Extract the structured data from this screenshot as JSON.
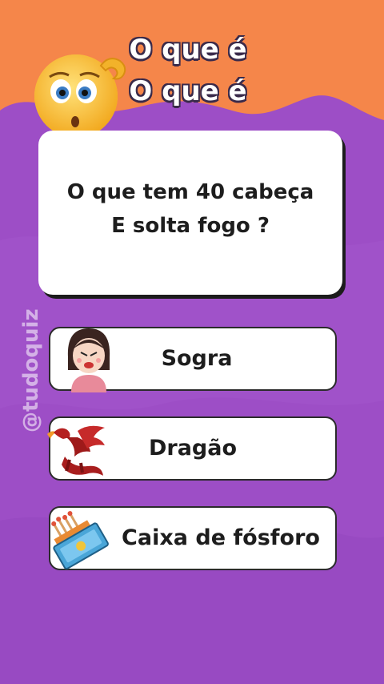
{
  "header": {
    "title_line1": "O que é",
    "title_line2": "O que é"
  },
  "question": {
    "line1": "O que tem 40 cabeça",
    "line2": "E solta fogo ?"
  },
  "answers": [
    {
      "label": "Sogra",
      "icon": "woman-icon"
    },
    {
      "label": "Dragão",
      "icon": "dragon-icon"
    },
    {
      "label": "Caixa de fósforo",
      "icon": "matchbox-icon"
    }
  ],
  "watermark": "@tudoquiz",
  "colors": {
    "orange": "#f5864a",
    "purple": "#9b4fc4",
    "card": "#ffffff"
  }
}
